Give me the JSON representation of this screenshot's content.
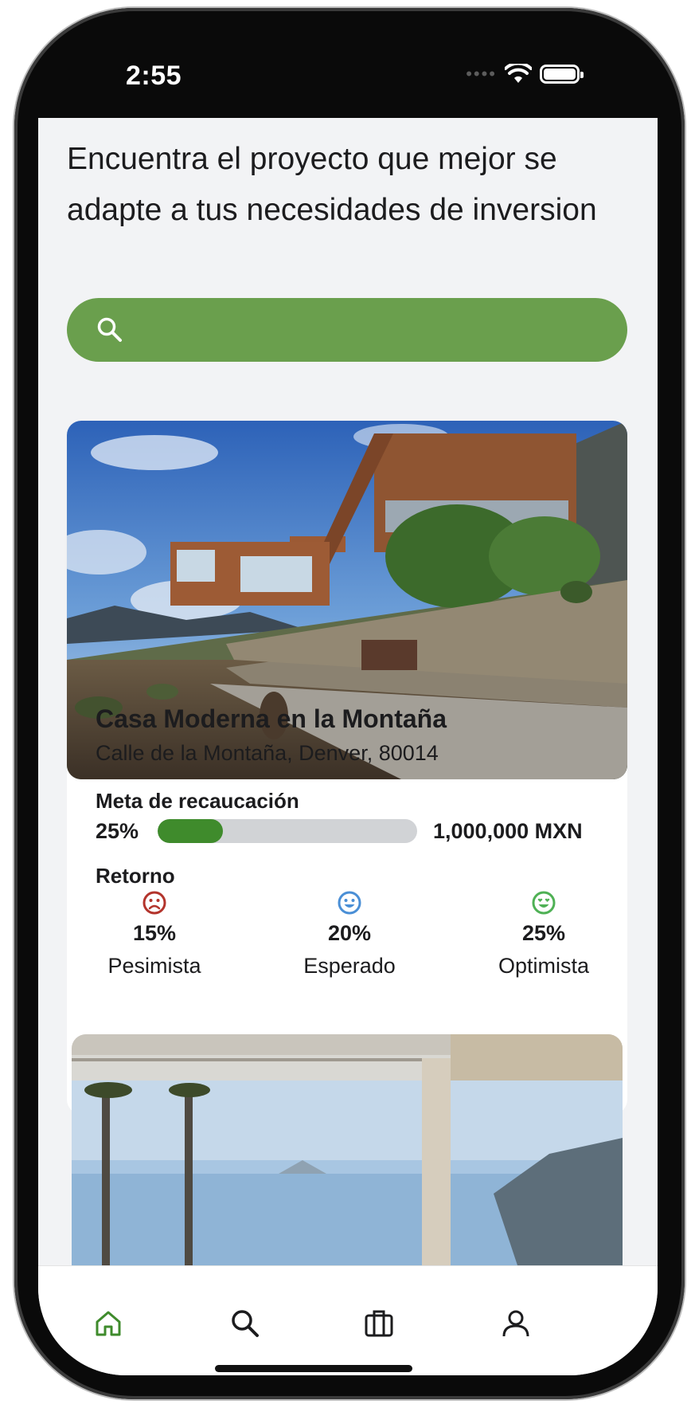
{
  "status_bar": {
    "time": "2:55"
  },
  "header": {
    "headline": "Encuentra el proyecto que mejor se adapte a tus necesidades de inversion"
  },
  "search": {
    "placeholder": "",
    "value": ""
  },
  "projects": [
    {
      "title": "Casa Moderna en la Montaña",
      "address": "Calle de la Montaña, Denver, 80014",
      "goal_label": "Meta de recaucación",
      "goal_percent": "25%",
      "goal_fraction": 0.25,
      "goal_amount": "1,000,000 MXN",
      "return_label": "Retorno",
      "scenarios": [
        {
          "value": "15%",
          "name": "Pesimista",
          "icon": "sad-face-icon",
          "color": "#b3342c"
        },
        {
          "value": "20%",
          "name": "Esperado",
          "icon": "happy-face-icon",
          "color": "#4a8fd6"
        },
        {
          "value": "25%",
          "name": "Optimista",
          "icon": "heart-eyes-face-icon",
          "color": "#4fb155"
        }
      ]
    }
  ],
  "tab_bar": {
    "tabs": [
      {
        "name": "home",
        "active": true
      },
      {
        "name": "search",
        "active": false
      },
      {
        "name": "portfolio",
        "active": false
      },
      {
        "name": "profile",
        "active": false
      }
    ],
    "active_color": "#3f8b2c",
    "inactive_color": "#1c1c1e"
  },
  "colors": {
    "accent": "#6a9f4d",
    "progress": "#3f8b2c",
    "background": "#f2f3f5"
  }
}
